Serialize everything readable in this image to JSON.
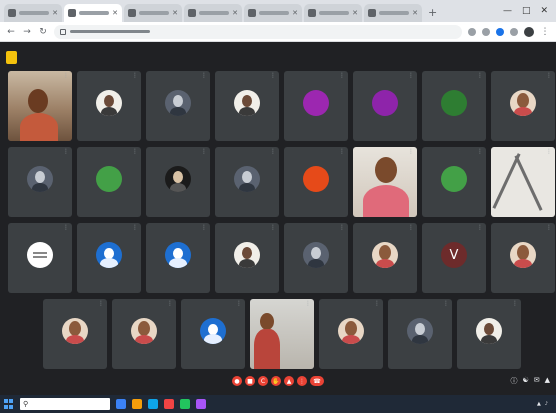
{
  "browser": {
    "tabs": [
      {
        "title": "",
        "active": false
      },
      {
        "title": "",
        "active": true
      },
      {
        "title": "",
        "active": false
      },
      {
        "title": "",
        "active": false
      },
      {
        "title": "",
        "active": false
      },
      {
        "title": "",
        "active": false
      },
      {
        "title": "",
        "active": false
      }
    ],
    "new_tab_icon": "plus-icon",
    "address": ""
  },
  "meeting": {
    "label": "",
    "participants": [
      {
        "name": "",
        "kind": "video",
        "style": "v1"
      },
      {
        "name": "",
        "kind": "avatar",
        "style": "photo-light",
        "initial": ""
      },
      {
        "name": "",
        "kind": "avatar",
        "style": "photo-grey",
        "initial": ""
      },
      {
        "name": "",
        "kind": "avatar",
        "style": "photo-light",
        "initial": ""
      },
      {
        "name": "",
        "kind": "initial",
        "color": "#9c27b0",
        "initial": ""
      },
      {
        "name": "",
        "kind": "initial",
        "color": "#8e24aa",
        "initial": ""
      },
      {
        "name": "",
        "kind": "initial",
        "color": "#2e7d32",
        "initial": ""
      },
      {
        "name": "",
        "kind": "avatar",
        "style": "photo-face",
        "initial": ""
      },
      {
        "name": "",
        "kind": "avatar",
        "style": "photo-grey",
        "initial": ""
      },
      {
        "name": "",
        "kind": "initial",
        "color": "#43a047",
        "initial": ""
      },
      {
        "name": "",
        "kind": "avatar",
        "style": "photo-dark",
        "initial": ""
      },
      {
        "name": "",
        "kind": "avatar",
        "style": "photo-grey",
        "initial": ""
      },
      {
        "name": "",
        "kind": "initial",
        "color": "#e64a19",
        "initial": ""
      },
      {
        "name": "",
        "kind": "video",
        "style": "v2"
      },
      {
        "name": "",
        "kind": "initial",
        "color": "#43a047",
        "initial": ""
      },
      {
        "name": "",
        "kind": "video",
        "style": "v3"
      },
      {
        "name": "",
        "kind": "avatar",
        "style": "photo-white",
        "initial": ""
      },
      {
        "name": "",
        "kind": "avatar",
        "style": "photo-blue",
        "initial": ""
      },
      {
        "name": "",
        "kind": "avatar",
        "style": "photo-blue",
        "initial": ""
      },
      {
        "name": "",
        "kind": "avatar",
        "style": "photo-light",
        "initial": ""
      },
      {
        "name": "",
        "kind": "avatar",
        "style": "photo-grey",
        "initial": ""
      },
      {
        "name": "",
        "kind": "avatar",
        "style": "photo-face",
        "initial": ""
      },
      {
        "name": "",
        "kind": "initial",
        "color": "#6d2b2b",
        "initial": "V"
      },
      {
        "name": "",
        "kind": "avatar",
        "style": "photo-face",
        "initial": ""
      },
      {
        "name": "",
        "kind": "avatar",
        "style": "photo-face",
        "initial": ""
      },
      {
        "name": "",
        "kind": "avatar",
        "style": "photo-face",
        "initial": ""
      },
      {
        "name": "",
        "kind": "avatar",
        "style": "photo-blue",
        "initial": ""
      },
      {
        "name": "",
        "kind": "video",
        "style": "v4"
      },
      {
        "name": "",
        "kind": "avatar",
        "style": "photo-face",
        "initial": ""
      },
      {
        "name": "",
        "kind": "avatar",
        "style": "photo-grey",
        "initial": ""
      },
      {
        "name": "",
        "kind": "avatar",
        "style": "photo-light",
        "initial": ""
      }
    ],
    "controls": [
      {
        "icon": "mic-icon"
      },
      {
        "icon": "camera-icon"
      },
      {
        "icon": "captions-icon"
      },
      {
        "icon": "raise-hand-icon"
      },
      {
        "icon": "present-icon"
      },
      {
        "icon": "more-icon"
      },
      {
        "icon": "end-call-icon"
      }
    ]
  },
  "taskbar": {
    "search_placeholder": "",
    "clock": ""
  },
  "colors": {
    "meet_bg": "#202124",
    "tile_bg": "#3c4043",
    "end_call": "#ea4335",
    "taskbar_bg": "#1f2937"
  }
}
